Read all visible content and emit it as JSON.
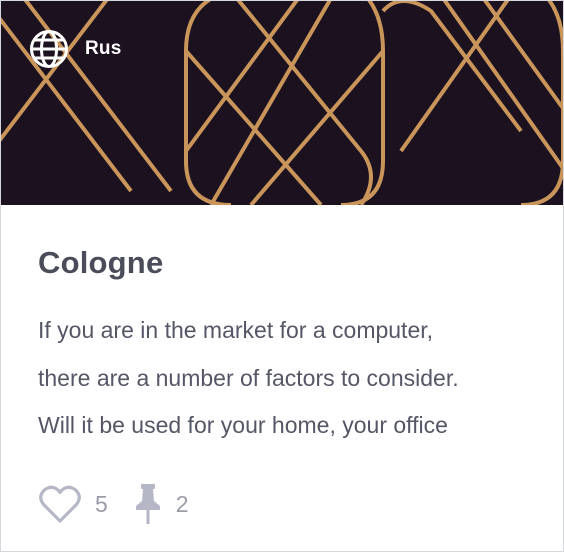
{
  "card": {
    "language": "Rus",
    "title": "Cologne",
    "excerpt_lines": [
      "If you are in the market for a computer,",
      "there are a number of factors to consider.",
      "Will it be used for your home, your office"
    ],
    "likes": "5",
    "pins": "2"
  },
  "icons": {
    "language": "globe-icon",
    "likes": "heart-icon",
    "pins": "pin-icon"
  },
  "colors": {
    "hero_background": "#1c111f",
    "pattern_gold": "#c9955a",
    "title": "#4a4c5a",
    "body_text": "#555766",
    "meta": "#9a9caa",
    "icon": "#b5b7c6"
  }
}
